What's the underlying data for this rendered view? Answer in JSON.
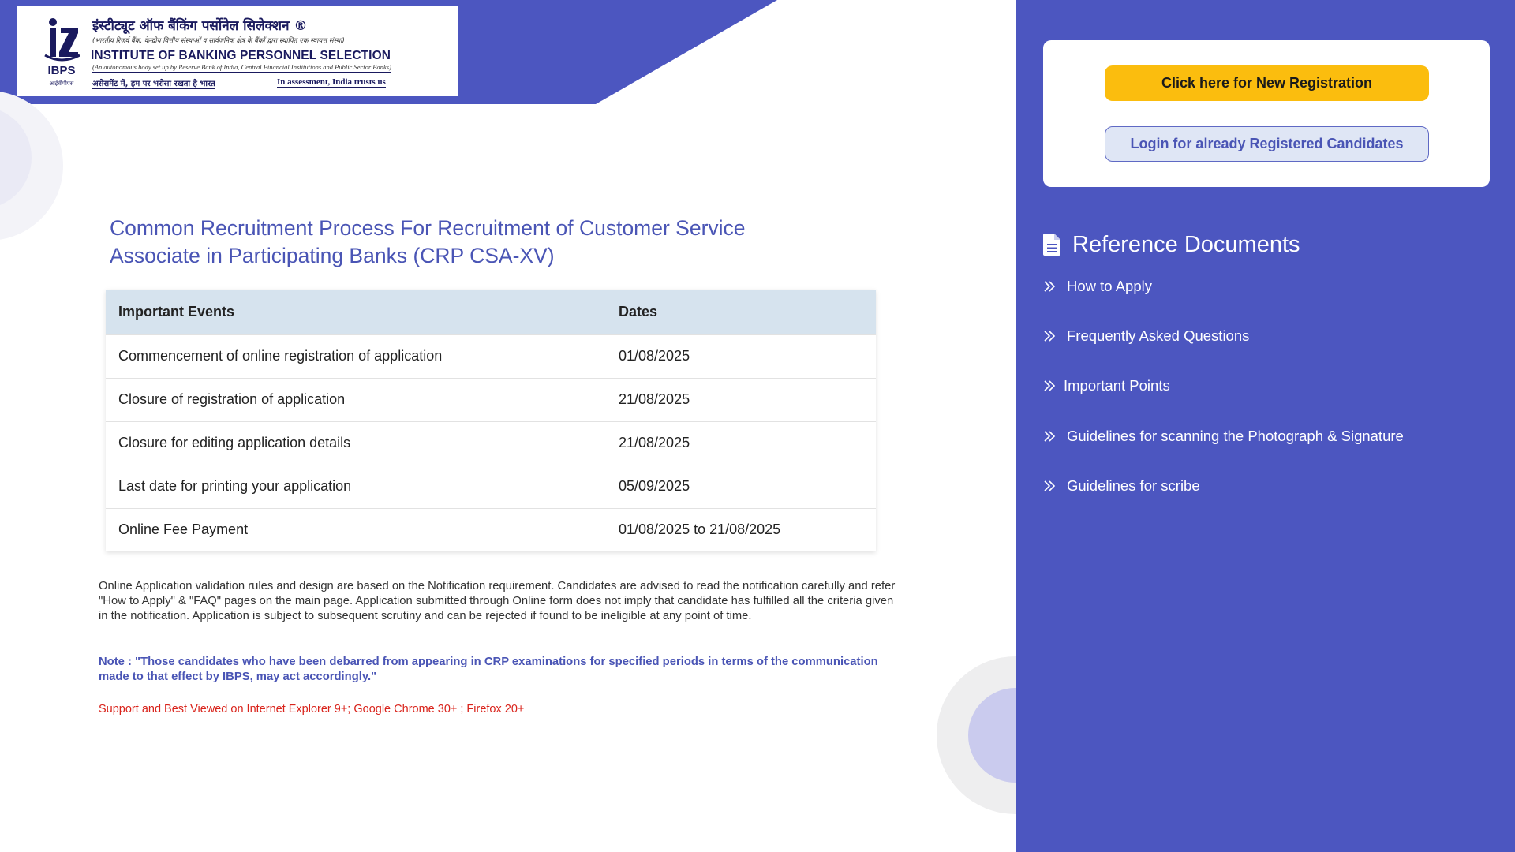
{
  "logo": {
    "hindi_title": "इंस्टीट्यूट ऑफ बैंकिंग पर्सोनेल सिलेक्शन",
    "registered_mark": "®",
    "hindi_subtitle": "(भारतीय रिज़र्व बैंक, केन्द्रीय वित्तीय संस्थाओं व सार्वजनिक क्षेत्र के बैंकों द्वारा स्थापित एक स्वायत्त संस्था)",
    "english_title": "INSTITUTE OF BANKING PERSONNEL SELECTION",
    "english_subtitle": "(An autonomous body set up by Reserve Bank of India, Central Financial Institutions and Public Sector Banks)",
    "tagline_hindi": "असेसमेंट में, हम पर भरोसा रखता है भारत",
    "tagline_english": "In assessment, India trusts us",
    "emblem_text": "IBPS",
    "emblem_hindi": "आईबीपीएस"
  },
  "main": {
    "heading": "Common Recruitment Process For Recruitment of Customer Service Associate in Participating Banks (CRP CSA-XV)",
    "table": {
      "headers": [
        "Important Events",
        "Dates"
      ],
      "rows": [
        {
          "event": "Commencement of online registration of application",
          "date": "01/08/2025"
        },
        {
          "event": "Closure of registration of application",
          "date": "21/08/2025"
        },
        {
          "event": "Closure for editing application details",
          "date": "21/08/2025"
        },
        {
          "event": "Last date for printing your application",
          "date": "05/09/2025"
        },
        {
          "event": "Online Fee Payment",
          "date": "01/08/2025 to 21/08/2025"
        }
      ]
    },
    "info_text": "Online Application validation rules and design are based on the Notification requirement. Candidates are advised to read the notification carefully and refer \"How to Apply\" & \"FAQ\" pages on the main page. Application submitted through Online form does not imply that candidate has fulfilled all the criteria given in the notification. Application is subject to subsequent scrutiny and can be rejected if found to be ineligible at any point of time.",
    "note_text": "Note : \"Those candidates who have been debarred from appearing in CRP examinations for specified periods in terms of the communication made to that effect by IBPS, may act accordingly.\"",
    "support_text": "Support and Best Viewed on Internet Explorer 9+; Google Chrome 30+ ; Firefox 20+"
  },
  "sidebar": {
    "register_label": "Click here for New Registration",
    "login_label": "Login for already Registered Candidates",
    "reference_title": "Reference Documents",
    "reference_items": [
      {
        "label": "How to Apply",
        "icon": "double-chevron-right-icon"
      },
      {
        "label": "Frequently Asked Questions",
        "icon": "double-chevron-right-icon"
      },
      {
        "label": "Important Points",
        "icon": "double-chevron-right-icon"
      },
      {
        "label": "Guidelines for scanning the Photograph & Signature",
        "icon": "double-chevron-right-icon"
      },
      {
        "label": "Guidelines for scribe",
        "icon": "double-chevron-right-icon"
      }
    ]
  },
  "colors": {
    "brand_blue": "#4c56c0",
    "heading_blue": "#4a55b5",
    "register_yellow": "#fbbd0e",
    "table_header": "#d6e3ee",
    "support_red": "#d9231b"
  }
}
